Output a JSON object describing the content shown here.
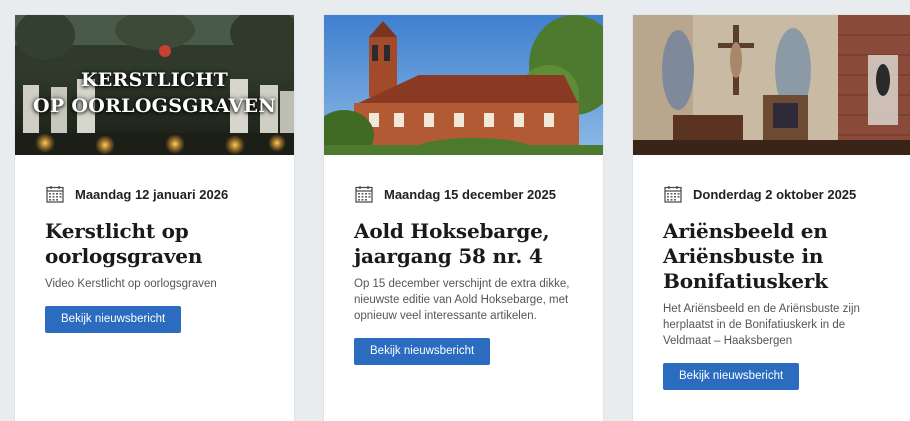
{
  "cards": [
    {
      "overlay_title_line1": "KERSTLICHT",
      "overlay_title_line2": "OP OORLOGSGRAVEN",
      "date": "Maandag 12 januari 2026",
      "title": "Kerstlicht op oorlogsgraven",
      "excerpt": "Video Kerstlicht op oorlogsgraven",
      "button_label": "Bekijk nieuwsbericht"
    },
    {
      "date": "Maandag 15 december 2025",
      "title": "Aold Hoksebarge, jaargang 58 nr. 4",
      "excerpt": "Op 15 december verschijnt de extra dikke, nieuwste editie van Aold Hoksebarge, met opnieuw veel interessante artikelen.",
      "button_label": "Bekijk nieuwsbericht"
    },
    {
      "date": "Donderdag 2 oktober 2025",
      "title": "Ariënsbeeld en Ariënsbuste in Bonifatiuskerk",
      "excerpt": "Het Ariënsbeeld en de Ariënsbuste zijn herplaatst in de Bonifatiuskerk in de Veldmaat – Haaksbergen",
      "button_label": "Bekijk nieuwsbericht"
    }
  ],
  "colors": {
    "button": "#2b6cc0",
    "background": "#e8ecef"
  },
  "icons": {
    "date": "calendar-icon"
  }
}
